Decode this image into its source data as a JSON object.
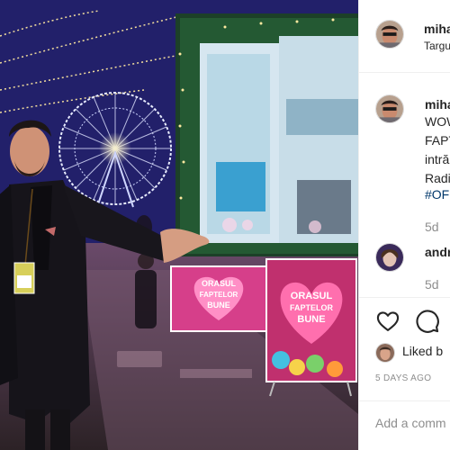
{
  "post": {
    "username": "miha",
    "location": "Targu",
    "caption_lines": [
      "WOW",
      "FAPT",
      "intră",
      "Radi"
    ],
    "hashtag": "#OF",
    "caption_time": "5d"
  },
  "comments": [
    {
      "username": "andr",
      "time": "5d"
    }
  ],
  "photo_signs": {
    "left": [
      "ORASUL",
      "FAPTELOR",
      "BUNE"
    ],
    "right": [
      "ORASUL",
      "FAPTELOR",
      "BUNE"
    ]
  },
  "actions": {
    "like_icon": "heart-icon",
    "comment_icon": "comment-icon"
  },
  "likes": {
    "prefix": "Liked b"
  },
  "post_date": "5 DAYS AGO",
  "add_comment": {
    "placeholder": "Add a comm"
  },
  "colors": {
    "hashtag": "#00376b",
    "muted": "#8e8e8e",
    "text": "#262626"
  }
}
